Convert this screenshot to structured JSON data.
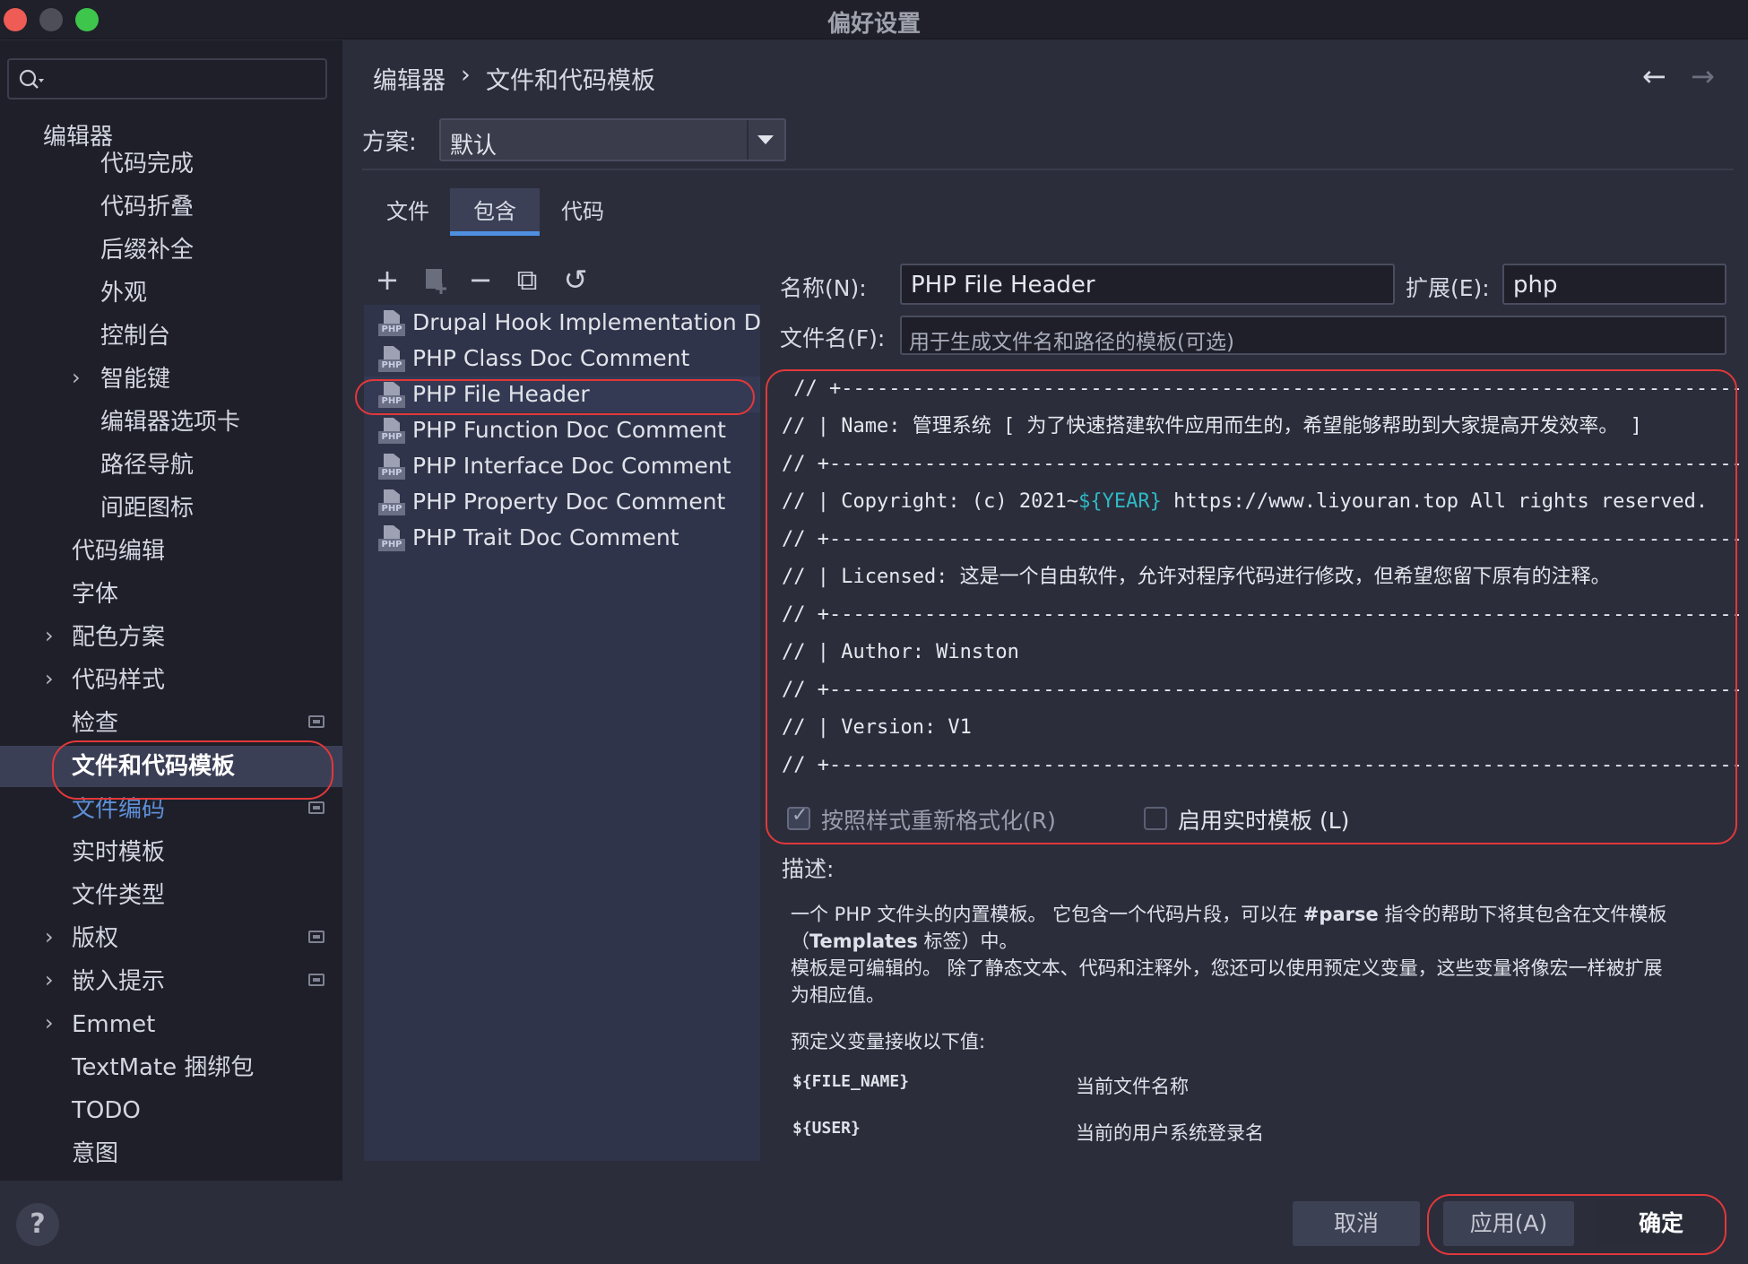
{
  "window": {
    "title": "偏好设置"
  },
  "search": {
    "placeholder": ""
  },
  "sidebar": {
    "items": [
      {
        "label": "编辑器"
      },
      {
        "label": "代码完成"
      },
      {
        "label": "代码折叠"
      },
      {
        "label": "后缀补全"
      },
      {
        "label": "外观"
      },
      {
        "label": "控制台"
      },
      {
        "label": "智能键"
      },
      {
        "label": "编辑器选项卡"
      },
      {
        "label": "路径导航"
      },
      {
        "label": "间距图标"
      },
      {
        "label": "代码编辑"
      },
      {
        "label": "字体"
      },
      {
        "label": "配色方案"
      },
      {
        "label": "代码样式"
      },
      {
        "label": "检查"
      },
      {
        "label": "文件和代码模板"
      },
      {
        "label": "文件编码"
      },
      {
        "label": "实时模板"
      },
      {
        "label": "文件类型"
      },
      {
        "label": "版权"
      },
      {
        "label": "嵌入提示"
      },
      {
        "label": "Emmet"
      },
      {
        "label": "TextMate 捆绑包"
      },
      {
        "label": "TODO"
      },
      {
        "label": "意图"
      }
    ],
    "selected": "文件和代码模板",
    "help_label": "?"
  },
  "breadcrumb": {
    "parent": "编辑器",
    "separator": "›",
    "current": "文件和代码模板"
  },
  "nav": {
    "back": "←",
    "forward": "→"
  },
  "scheme": {
    "label": "方案:",
    "value": "默认"
  },
  "tabs": [
    {
      "label": "文件"
    },
    {
      "label": "包含",
      "active": true
    },
    {
      "label": "代码"
    }
  ],
  "toolbar": {
    "add": "+",
    "remove": "−",
    "copy": "⧉",
    "reset": "↺"
  },
  "templates": [
    {
      "name": "Drupal Hook Implementation Doc Comment"
    },
    {
      "name": "PHP Class Doc Comment"
    },
    {
      "name": "PHP File Header",
      "selected": true
    },
    {
      "name": "PHP Function Doc Comment"
    },
    {
      "name": "PHP Interface Doc Comment"
    },
    {
      "name": "PHP Property Doc Comment"
    },
    {
      "name": "PHP Trait Doc Comment"
    }
  ],
  "php_badge": "PHP",
  "form": {
    "name_label": "名称(N):",
    "name_value": "PHP File Header",
    "ext_label": "扩展(E):",
    "ext_value": "php",
    "filename_label": "文件名(F):",
    "filename_placeholder": "用于生成文件名和路径的模板(可选)"
  },
  "code": {
    "rule": " // +------------------------------------------------------------------------------------",
    "rule2": "// +------------------------------------------------------------------------------------",
    "name_line": "// | Name: 管理系统 [ 为了快速搭建软件应用而生的，希望能够帮助到大家提高开发效率。 ]",
    "copyright_prefix": "// | Copyright: (c) 2021~",
    "copyright_var": "${YEAR}",
    "copyright_suffix": " https://www.liyouran.top All rights reserved.",
    "license_line": "// | Licensed: 这是一个自由软件，允许对程序代码进行修改，但希望您留下原有的注释。",
    "author_line": "// | Author: Winston",
    "version_line": "// | Version: V1"
  },
  "options": {
    "reformat_label": "按照样式重新格式化(R)",
    "reformat_checked": true,
    "live_label": "启用实时模板 (L)",
    "live_checked": false
  },
  "description": {
    "title": "描述:",
    "p1_a": "一个 PHP 文件头的内置模板。 它包含一个代码片段，可以在 ",
    "p1_bold": "#parse",
    "p1_b": " 指令的帮助下将其包含在文件模板",
    "p2_a": "（",
    "p2_bold": "Templates",
    "p2_b": " 标签）中。",
    "p3": "模板是可编辑的。 除了静态文本、代码和注释外，您还可以使用预定义变量，这些变量将像宏一样被扩展",
    "p4": "为相应值。",
    "p5": "预定义变量接收以下值:",
    "vars": [
      {
        "name": "${FILE_NAME}",
        "desc": "当前文件名称"
      },
      {
        "name": "${USER}",
        "desc": "当前的用户系统登录名"
      }
    ]
  },
  "buttons": {
    "cancel": "取消",
    "apply": "应用(A)",
    "ok": "确定"
  },
  "colors": {
    "accent": "#4e8fe0",
    "annotation": "#e2383a",
    "variable": "#2fb8c4"
  }
}
